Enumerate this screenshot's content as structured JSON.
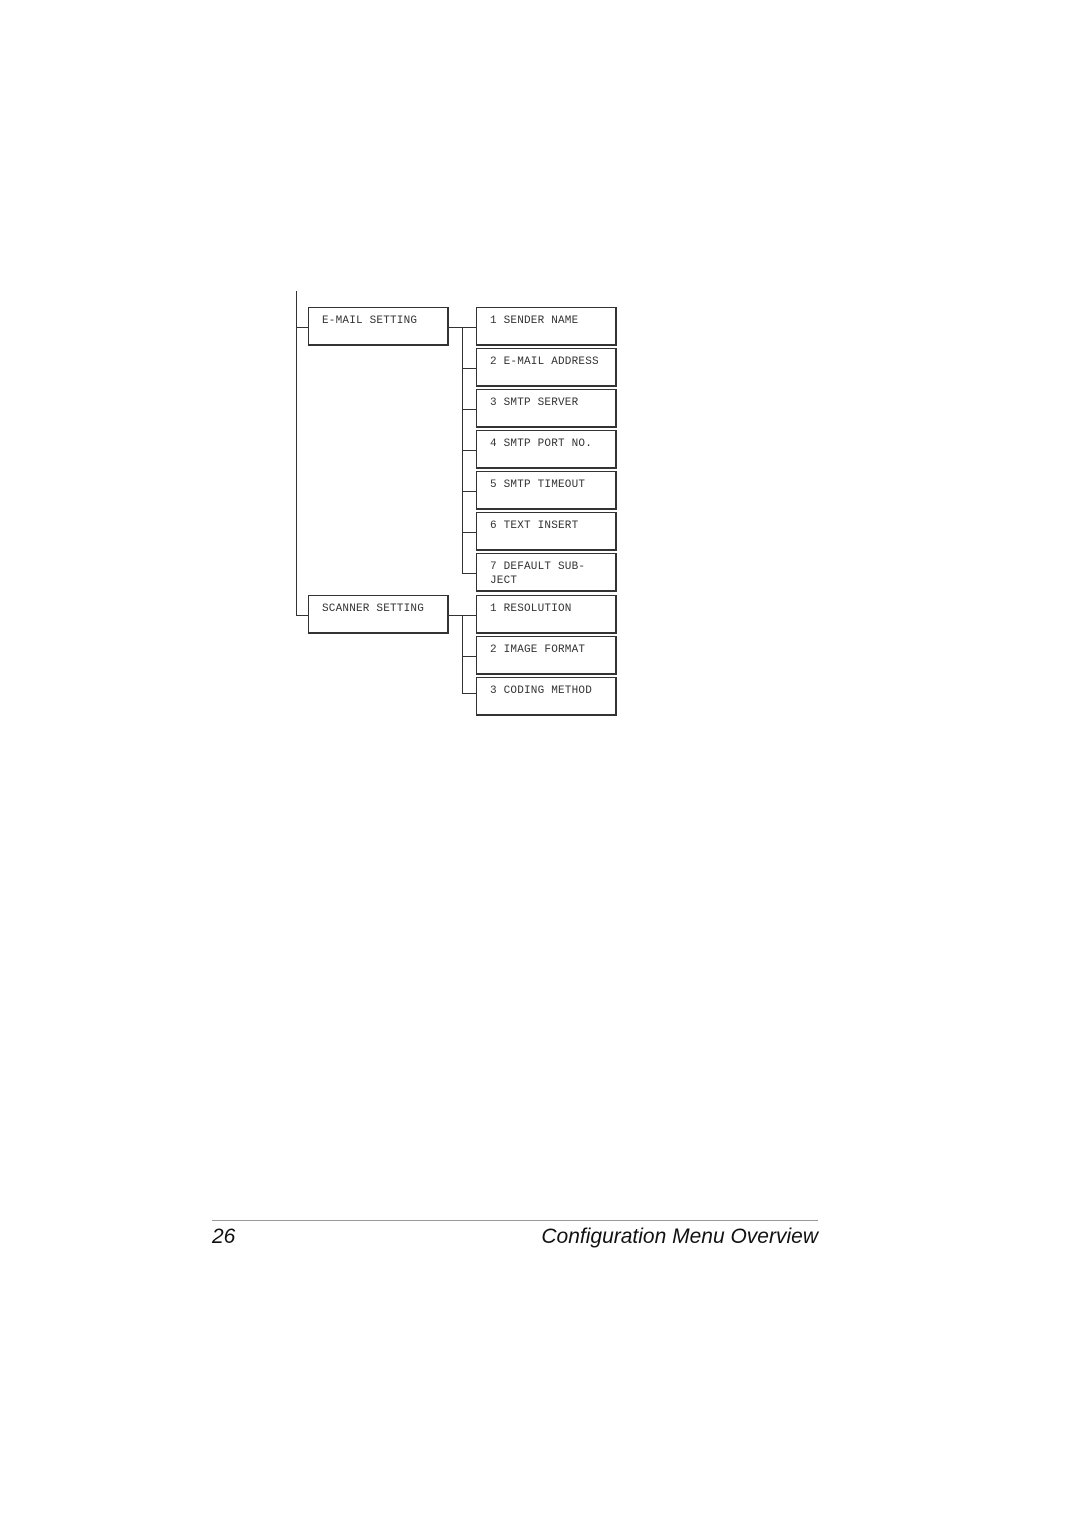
{
  "diagram": {
    "groups": [
      {
        "label": "E-MAIL SETTING",
        "items": [
          "1 SENDER NAME",
          "2 E-MAIL ADDRESS",
          "3 SMTP SERVER",
          "4 SMTP PORT NO.",
          "5 SMTP TIMEOUT",
          "6 TEXT INSERT",
          "7 DEFAULT SUB-JECT"
        ]
      },
      {
        "label": "SCANNER SETTING",
        "items": [
          "1 RESOLUTION",
          "2 IMAGE FORMAT",
          "3 CODING METHOD"
        ]
      }
    ],
    "line_color": "#333333"
  },
  "footer": {
    "page_number": "26",
    "title": "Configuration Menu Overview"
  }
}
